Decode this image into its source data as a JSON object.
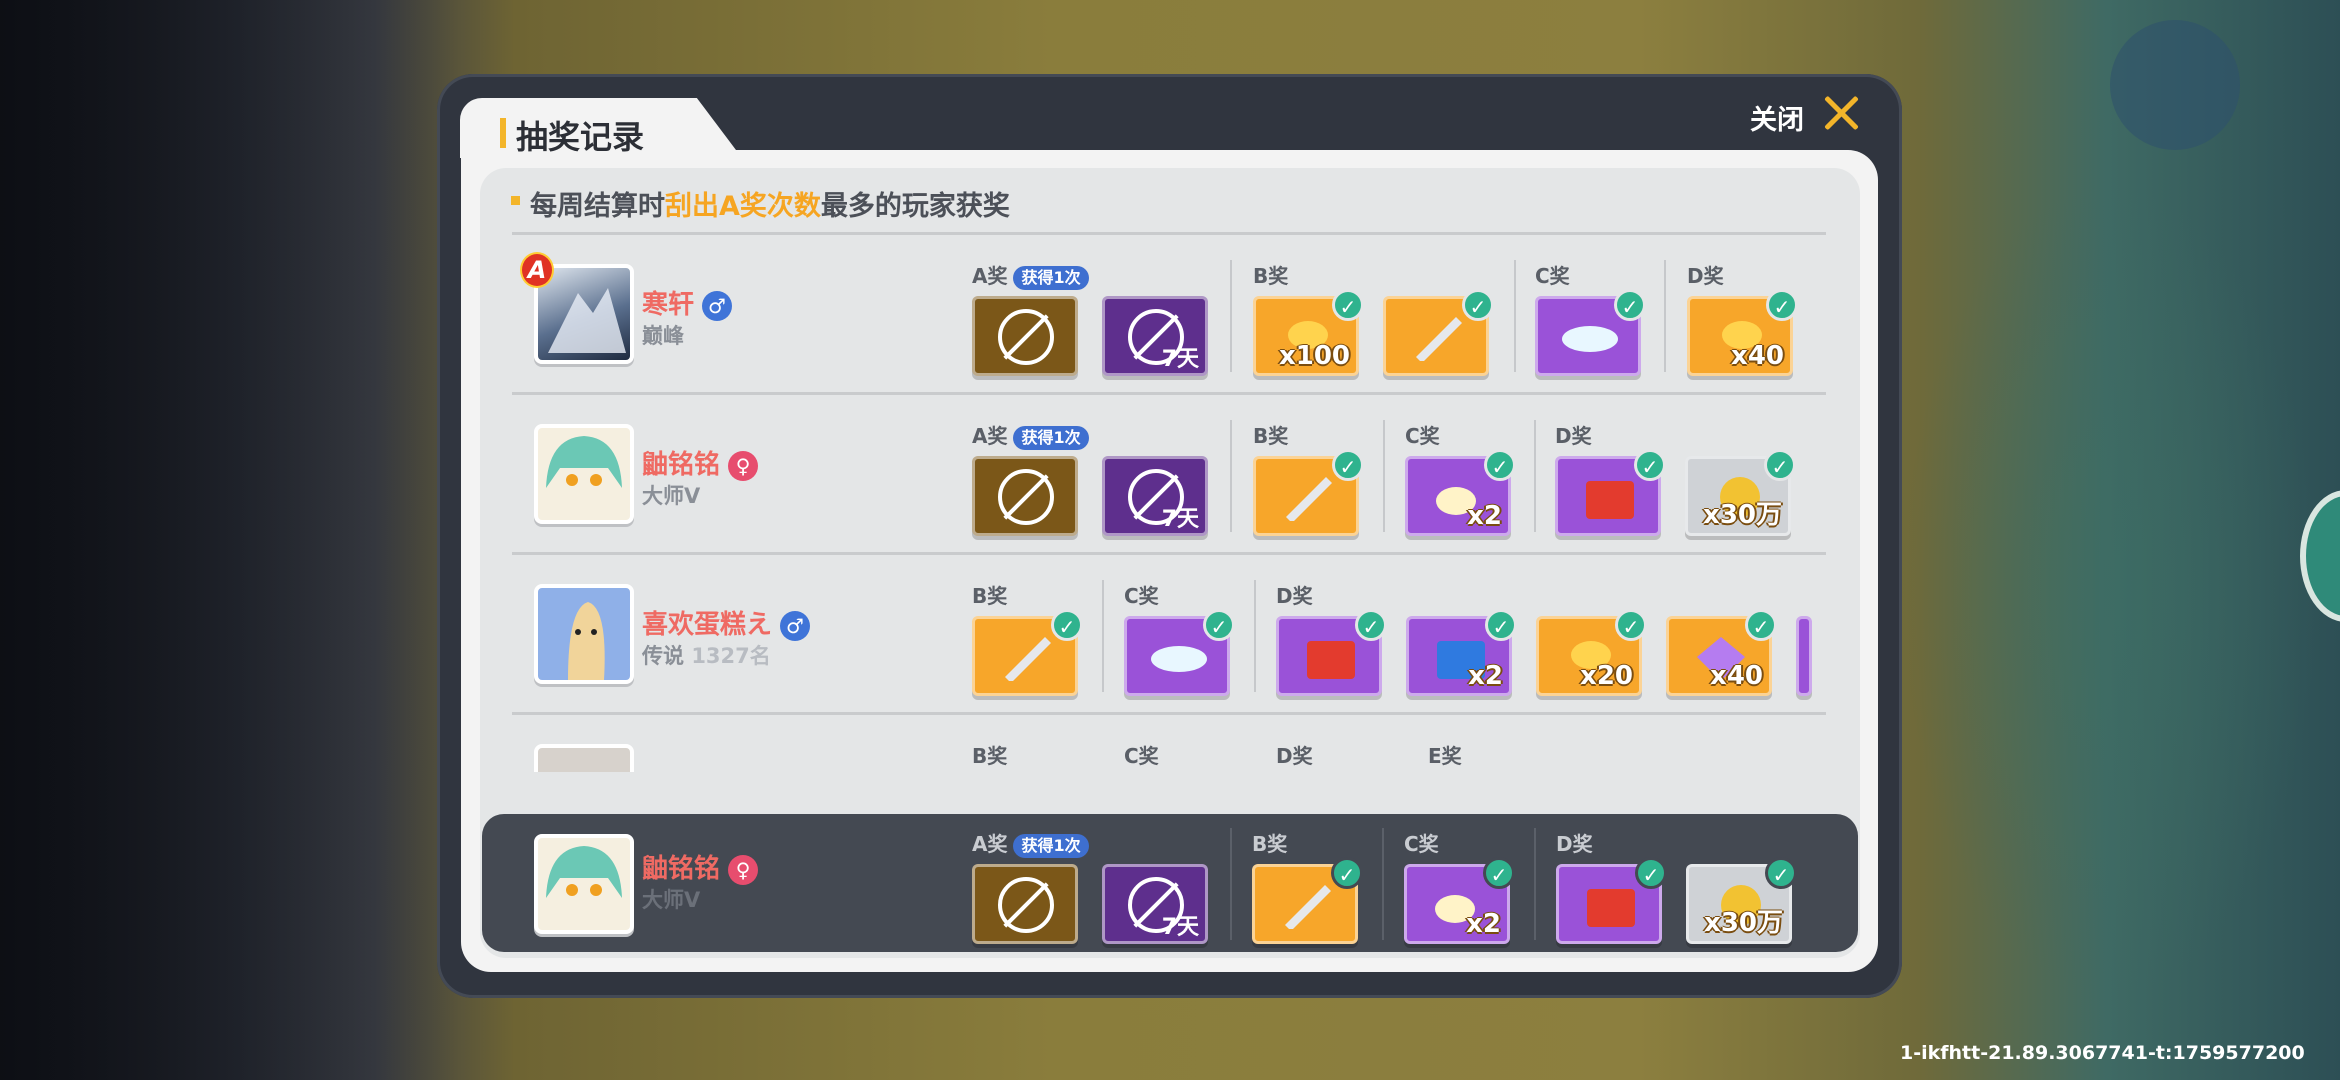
{
  "modal": {
    "title": "抽奖记录",
    "close_label": "关闭"
  },
  "rule": {
    "prefix": "每周结算时",
    "highlight": "刮出A奖次数",
    "suffix": "最多的玩家获奖"
  },
  "rows": [
    {
      "name": "寒轩",
      "gender": "male",
      "gender_symbol": "♂",
      "rank": "巅峰",
      "rank_badge": "A",
      "groups": [
        {
          "label": "A奖",
          "badge": "获得1次",
          "items": [
            {
              "type": "ban",
              "color": "brown"
            },
            {
              "type": "ban",
              "color": "dpurple",
              "tag": "7天"
            }
          ]
        },
        {
          "label": "B奖",
          "items": [
            {
              "color": "orange",
              "qty": "x100",
              "icon": "candy-icon"
            },
            {
              "color": "orange",
              "icon": "sword-icon"
            }
          ]
        },
        {
          "label": "C奖",
          "items": [
            {
              "color": "purple",
              "icon": "car-icon"
            }
          ]
        },
        {
          "label": "D奖",
          "items": [
            {
              "color": "orange",
              "qty": "x40",
              "icon": "candy-icon"
            }
          ]
        }
      ]
    },
    {
      "name": "鼬铭铭",
      "gender": "female",
      "gender_symbol": "♀",
      "rank": "大师V",
      "groups": [
        {
          "label": "A奖",
          "badge": "获得1次",
          "items": [
            {
              "type": "ban",
              "color": "brown"
            },
            {
              "type": "ban",
              "color": "dpurple",
              "tag": "7天"
            }
          ]
        },
        {
          "label": "B奖",
          "items": [
            {
              "color": "orange",
              "icon": "sword-icon"
            }
          ]
        },
        {
          "label": "C奖",
          "items": [
            {
              "color": "purple",
              "qty": "x2",
              "icon": "cloud-icon"
            }
          ]
        },
        {
          "label": "D奖",
          "items": [
            {
              "color": "purple",
              "icon": "red-chest-icon"
            },
            {
              "color": "silver",
              "qty": "x30万",
              "icon": "coin-icon"
            }
          ]
        }
      ]
    },
    {
      "name": "喜欢蛋糕え",
      "gender": "male",
      "gender_symbol": "♂",
      "rank": "传说",
      "rank_extra": "1327名",
      "groups": [
        {
          "label": "B奖",
          "items": [
            {
              "color": "orange",
              "icon": "sword-icon"
            }
          ]
        },
        {
          "label": "C奖",
          "items": [
            {
              "color": "purple",
              "icon": "car-icon"
            }
          ]
        },
        {
          "label": "D奖",
          "items": [
            {
              "color": "purple",
              "icon": "red-chest-icon"
            },
            {
              "color": "purple",
              "qty": "x2",
              "icon": "blue-chest-icon"
            },
            {
              "color": "orange",
              "qty": "x20",
              "icon": "candy-icon"
            },
            {
              "color": "orange",
              "qty": "x40",
              "icon": "gem-icon"
            }
          ]
        }
      ]
    },
    {
      "name": "",
      "gender": "male",
      "gender_symbol": "",
      "rank": "",
      "groups": [
        {
          "label": "B奖",
          "items": []
        },
        {
          "label": "C奖",
          "items": []
        },
        {
          "label": "D奖",
          "items": []
        },
        {
          "label": "E奖",
          "items": []
        }
      ]
    }
  ],
  "me": {
    "name": "鼬铭铭",
    "gender_symbol": "♀",
    "rank": "大师V",
    "groups": [
      {
        "label": "A奖",
        "badge": "获得1次"
      },
      {
        "label": "B奖"
      },
      {
        "label": "C奖",
        "qty": "x2"
      },
      {
        "label": "D奖",
        "qty": "x30万"
      }
    ]
  },
  "watermark": "1-ikfhtt-21.89.3067741-t:1759577200",
  "colors": {
    "accent": "#f3b52a",
    "highlight": "#f6a522",
    "name": "#ef6a63",
    "check": "#2fb38e"
  }
}
